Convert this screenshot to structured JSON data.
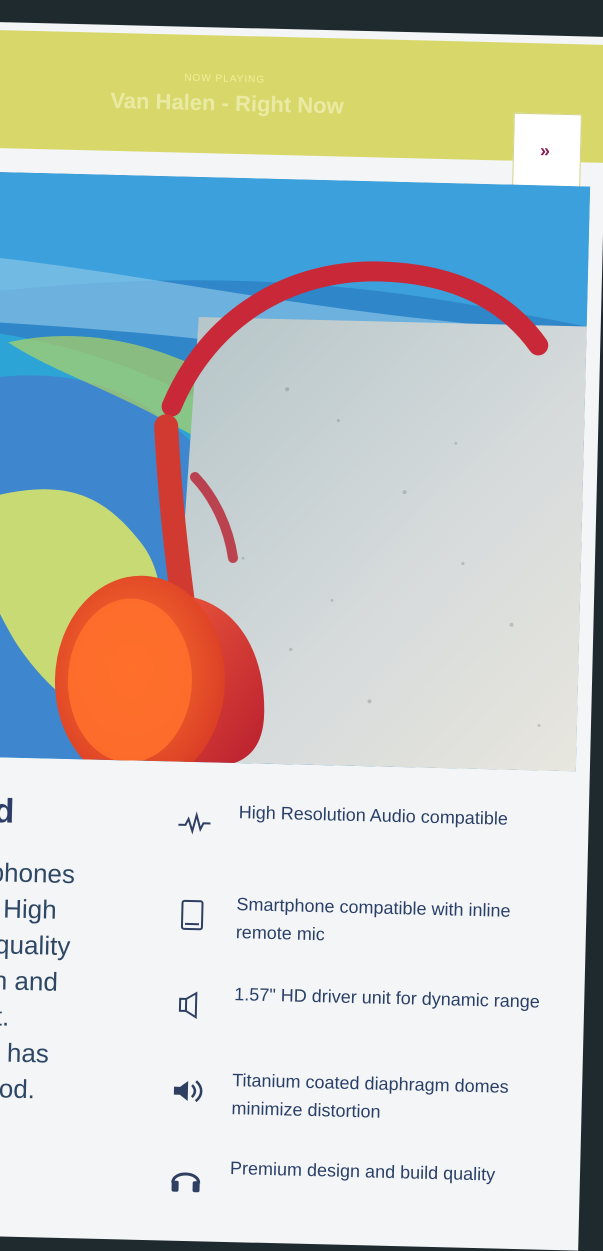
{
  "now_playing": {
    "kicker": "NOW PLAYING",
    "track": "Van Halen - Right Now",
    "next_symbol": "»"
  },
  "hero": {
    "alt": "Red on-ear headphones resting on a concrete block with colorful headphones behind"
  },
  "left_column": {
    "title_fragment": "ed",
    "body_lines": [
      "dphones",
      "m High",
      "o quality",
      "ign and",
      "ort.",
      "nd has",
      "good."
    ]
  },
  "features": [
    {
      "icon": "waveform-icon",
      "text": "High Resolution Audio compatible"
    },
    {
      "icon": "smartphone-icon",
      "text": "Smartphone compatible with inline remote mic"
    },
    {
      "icon": "driver-icon",
      "text": "1.57\" HD driver unit for dynamic range"
    },
    {
      "icon": "speaker-volume-icon",
      "text": "Titanium coated diaphragm domes minimize distortion"
    },
    {
      "icon": "headphones-icon",
      "text": "Premium design and build quality"
    }
  ]
}
